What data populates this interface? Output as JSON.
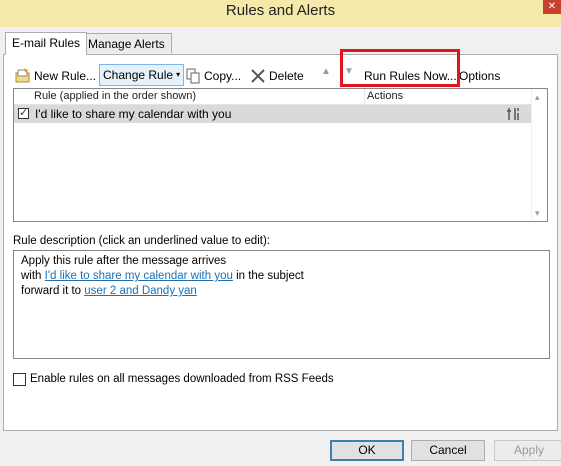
{
  "window": {
    "title": "Rules and Alerts",
    "close_glyph": "✕"
  },
  "tabs": [
    {
      "label": "E-mail Rules",
      "active": true
    },
    {
      "label": "Manage Alerts",
      "active": false
    }
  ],
  "toolbar": {
    "new_rule": "New Rule...",
    "change_rule": "Change Rule",
    "copy": "Copy...",
    "delete": "Delete",
    "run_rules_now": "Run Rules Now...",
    "options": "Options",
    "move_up_glyph": "▲",
    "move_down_glyph": "▼",
    "caret_glyph": "▾"
  },
  "rules_list": {
    "columns": [
      "Rule (applied in the order shown)",
      "Actions"
    ],
    "rows": [
      {
        "name": "I'd like to share my calendar with you",
        "enabled": true,
        "check_glyph": "✓"
      }
    ]
  },
  "description": {
    "label": "Rule description (click an underlined value to edit):",
    "line1": "Apply this rule after the message arrives",
    "line2_prefix": "with",
    "line2_link": "I'd like to share my calendar with you",
    "line2_suffix": "in the subject",
    "line3_prefix": "forward it to",
    "line3_link": "user 2 and Dandy yan"
  },
  "rss_option": {
    "label": "Enable rules on all messages downloaded from RSS Feeds",
    "checked": false
  },
  "footer": {
    "ok": "OK",
    "cancel": "Cancel",
    "apply": "Apply"
  },
  "colors": {
    "title_bar": "#f4e9a8",
    "highlight": "#e2141c",
    "link": "#1f6fb0"
  }
}
